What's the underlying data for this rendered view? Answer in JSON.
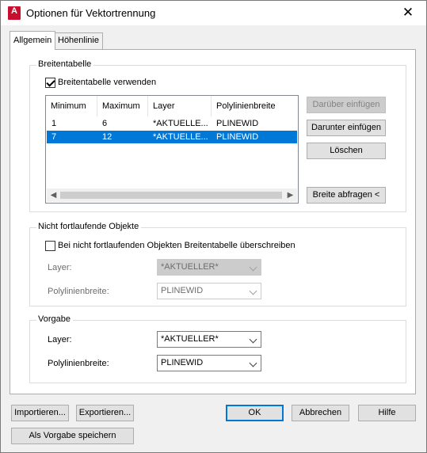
{
  "window": {
    "title": "Optionen für Vektortrennung",
    "app_icon_letter": "A",
    "close_glyph": "✕"
  },
  "tabs": [
    {
      "label": "Allgemein",
      "active": true
    },
    {
      "label": "Höhenlinie",
      "active": false
    }
  ],
  "breitentabelle": {
    "group_title": "Breitentabelle",
    "use_checkbox_label": "Breitentabelle verwenden",
    "use_checked": true,
    "columns": [
      "Minimum",
      "Maximum",
      "Layer",
      "Polylinienbreite"
    ],
    "rows": [
      {
        "minimum": "1",
        "maximum": "6",
        "layer": "*AKTUELLE...",
        "polylinienbreite": "PLINEWID",
        "selected": false
      },
      {
        "minimum": "7",
        "maximum": "12",
        "layer": "*AKTUELLE...",
        "polylinienbreite": "PLINEWID",
        "selected": true
      }
    ],
    "buttons": {
      "insert_above": "Darüber einfügen",
      "insert_below": "Darunter einfügen",
      "delete": "Löschen",
      "query_width": "Breite abfragen <"
    }
  },
  "nicht_fortlaufend": {
    "group_title": "Nicht fortlaufende Objekte",
    "override_checkbox_label": "Bei nicht fortlaufenden Objekten Breitentabelle überschreiben",
    "override_checked": false,
    "layer_label": "Layer:",
    "layer_value": "*AKTUELLER*",
    "width_label": "Polylinienbreite:",
    "width_value": "PLINEWID"
  },
  "vorgabe": {
    "group_title": "Vorgabe",
    "layer_label": "Layer:",
    "layer_value": "*AKTUELLER*",
    "width_label": "Polylinienbreite:",
    "width_value": "PLINEWID"
  },
  "footer": {
    "import": "Importieren...",
    "export": "Exportieren...",
    "ok": "OK",
    "cancel": "Abbrechen",
    "help": "Hilfe",
    "save_default": "Als Vorgabe speichern"
  },
  "colors": {
    "selection": "#0078d7",
    "icon_red": "#c8102e"
  }
}
